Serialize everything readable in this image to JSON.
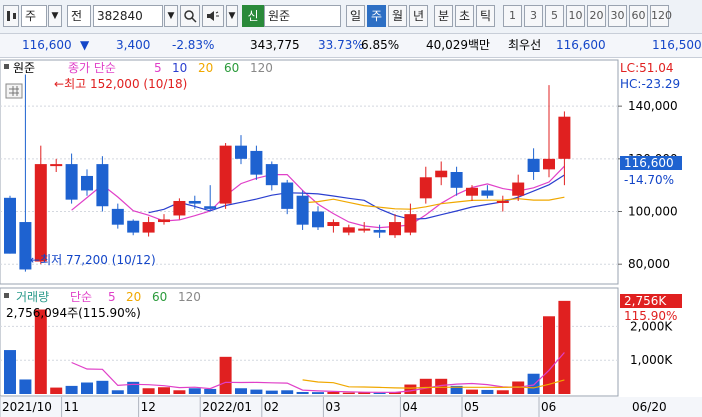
{
  "toolbar": {
    "market_label": "주",
    "type_label": "전",
    "code": "382840",
    "badge": "신",
    "stock_name": "원준",
    "periods": [
      "일",
      "주",
      "월",
      "년",
      "분",
      "초",
      "틱"
    ],
    "selected_period": "주",
    "intervals": [
      "1",
      "3",
      "5",
      "10",
      "20",
      "30",
      "60",
      "120"
    ]
  },
  "quote": {
    "price": "116,600",
    "change": "3,400",
    "change_rate": "-2.83%",
    "volume": "343,775",
    "volume_ratio": "33.73%",
    "turnover_rate": "6.85%",
    "trade_value": "40,029백만",
    "quote_label": "최우선",
    "bid": "116,600",
    "ask": "116,500"
  },
  "price_panel": {
    "stock_name": "원준",
    "ma_label": "종가 단순",
    "ma_periods": [
      "5",
      "10",
      "20",
      "60",
      "120"
    ],
    "lc": "LC:51.04",
    "hc": "HC:-23.29",
    "high_label": "최고 152,000 (10/18)",
    "low_label": "최저 77,200 (10/12)",
    "price_ticks": [
      "140,000",
      "120,000",
      "100,000",
      "80,000"
    ],
    "current_price": "116,600",
    "current_rate": "-14.70%"
  },
  "volume_panel": {
    "title": "거래량",
    "ma_label": "단순",
    "ma_periods": [
      "5",
      "20",
      "60",
      "120"
    ],
    "value_text": "2,756,094주(115.90%)",
    "ticks": [
      "2,000K",
      "1,000K"
    ],
    "current": "2,756K",
    "current_rate": "115.90%"
  },
  "x_axis": {
    "labels": [
      "2021/10",
      "11",
      "12",
      "2022/01",
      "02",
      "03",
      "04",
      "05",
      "06"
    ],
    "right_label": "06/20"
  },
  "colors": {
    "up": "#e02020",
    "down": "#1e62d0",
    "ma5": "#e040c8",
    "ma10": "#2b3fcf",
    "ma20": "#f0a800"
  },
  "chart_data": {
    "type": "candlestick",
    "x": [
      "2021/10/08",
      "10/15",
      "10/22",
      "10/29",
      "11/05",
      "11/12",
      "11/19",
      "11/26",
      "12/03",
      "12/10",
      "12/17",
      "12/24",
      "12/31",
      "2022/01/07",
      "01/14",
      "01/21",
      "01/28",
      "02/04",
      "02/11",
      "02/18",
      "02/25",
      "03/04",
      "03/11",
      "03/18",
      "03/25",
      "04/01",
      "04/08",
      "04/15",
      "04/22",
      "04/29",
      "05/06",
      "05/13",
      "05/20",
      "05/27",
      "06/03",
      "06/10",
      "06/17"
    ],
    "series": [
      {
        "name": "원준",
        "open": [
          105200,
          96000,
          81000,
          118000,
          118000,
          113500,
          118000,
          101000,
          96500,
          92000,
          96000,
          98500,
          104000,
          102000,
          103000,
          125000,
          123000,
          118000,
          111000,
          106000,
          100000,
          94500,
          92000,
          93000,
          93000,
          91000,
          92000,
          105000,
          113000,
          115000,
          106000,
          108000,
          104000,
          106000,
          120000,
          116000,
          120000
        ],
        "close": [
          84000,
          78000,
          118000,
          118000,
          104500,
          108000,
          102000,
          95000,
          92000,
          96000,
          97000,
          104000,
          103000,
          101000,
          125000,
          120000,
          114000,
          110000,
          101000,
          95000,
          94000,
          96000,
          94000,
          93500,
          92000,
          96000,
          99000,
          113000,
          115500,
          109000,
          109000,
          106000,
          104000,
          111000,
          115000,
          120000,
          136000
        ],
        "high": [
          106000,
          152000,
          125000,
          120000,
          122000,
          116000,
          121000,
          103000,
          97000,
          98000,
          99000,
          105000,
          106000,
          110000,
          126000,
          129000,
          125000,
          119000,
          112000,
          108000,
          102000,
          97000,
          95000,
          96000,
          95000,
          99000,
          103000,
          117000,
          119000,
          117000,
          110000,
          110000,
          106000,
          114000,
          124000,
          148000,
          138000
        ],
        "low": [
          84000,
          77200,
          80000,
          115000,
          103000,
          106000,
          100000,
          93500,
          91000,
          90500,
          95000,
          97000,
          101000,
          100000,
          101000,
          118000,
          112000,
          108000,
          99000,
          93000,
          93000,
          92000,
          91000,
          92000,
          90000,
          90000,
          91000,
          103000,
          110000,
          106000,
          104000,
          105000,
          100000,
          104000,
          112000,
          113000,
          110000
        ]
      }
    ],
    "volume": [
      1300,
      430,
      2500,
      190,
      240,
      340,
      390,
      110,
      360,
      170,
      200,
      110,
      170,
      150,
      1100,
      170,
      130,
      100,
      110,
      60,
      55,
      60,
      40,
      55,
      35,
      50,
      280,
      450,
      450,
      240,
      130,
      120,
      110,
      370,
      600,
      2300,
      2756
    ],
    "ylim": [
      74000,
      156000
    ],
    "volume_unit": "K"
  }
}
